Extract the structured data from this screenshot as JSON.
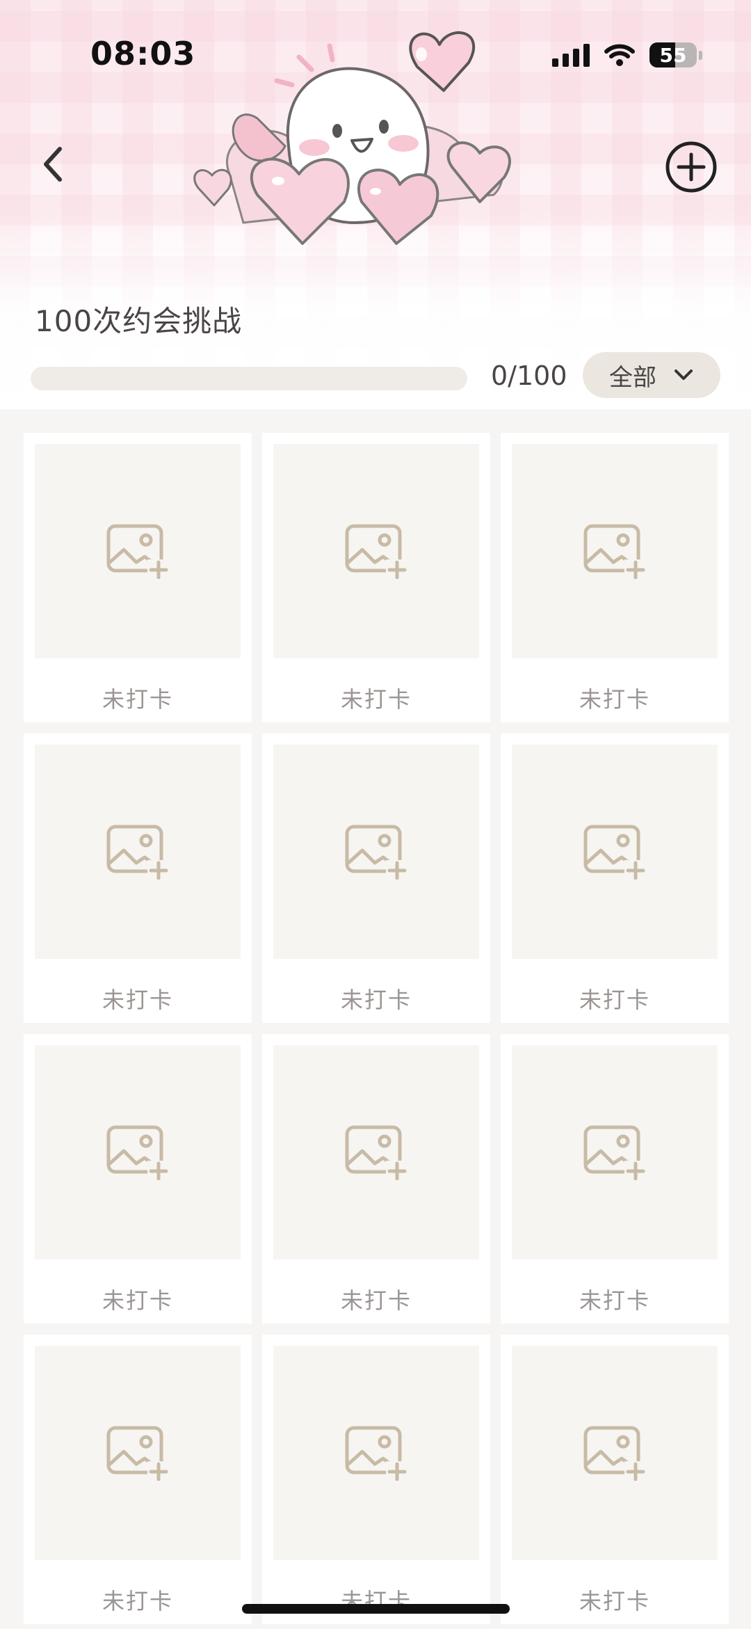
{
  "status_bar": {
    "time": "08:03",
    "battery": "55",
    "icons": [
      "signal-icon",
      "wifi-icon",
      "battery-icon"
    ]
  },
  "header": {
    "title": "100次约会挑战",
    "progress_text": "0/100",
    "progress_fraction": 0,
    "filter_label": "全部",
    "back_icon": "chevron-left-icon",
    "add_icon": "plus-circle-icon",
    "illustration": "cartoon-egg-with-hearts"
  },
  "grid": {
    "columns": 3,
    "items": [
      {
        "status": "未打卡"
      },
      {
        "status": "未打卡"
      },
      {
        "status": "未打卡"
      },
      {
        "status": "未打卡"
      },
      {
        "status": "未打卡"
      },
      {
        "status": "未打卡"
      },
      {
        "status": "未打卡"
      },
      {
        "status": "未打卡"
      },
      {
        "status": "未打卡"
      },
      {
        "status": "未打卡"
      },
      {
        "status": "未打卡"
      },
      {
        "status": "未打卡"
      }
    ],
    "placeholder_icon": "add-photo-icon"
  },
  "colors": {
    "header_pink": "#fbe9ee",
    "text_dark": "#4a4545",
    "text_muted": "#9a9593",
    "icon_beige": "#c8bba6",
    "filter_bg": "#ebe6df",
    "page_bg": "#f7f5f3"
  }
}
